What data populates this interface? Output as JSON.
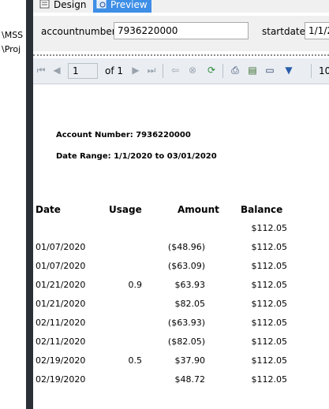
{
  "left_pane": {
    "lines": [
      "\\MSS",
      "\\Proj"
    ]
  },
  "tabs": [
    {
      "label": "Design"
    },
    {
      "label": "Preview"
    }
  ],
  "params": {
    "account_label": "accountnumber",
    "account_value": "7936220000",
    "start_label": "startdate",
    "start_value": "1/1/2"
  },
  "toolbar": {
    "page_current": "1",
    "page_of": "of 1",
    "zoom": "10"
  },
  "report": {
    "account_line": "Account Number: 7936220000",
    "date_line": "Date Range: 1/1/2020 to 03/01/2020",
    "columns": [
      "Date",
      "Usage",
      "Amount",
      "Balance"
    ],
    "rows": [
      {
        "date": "",
        "usage": "",
        "amount": "",
        "balance": "$112.05"
      },
      {
        "date": "01/07/2020",
        "usage": "",
        "amount": "($48.96)",
        "balance": "$112.05"
      },
      {
        "date": "01/07/2020",
        "usage": "",
        "amount": "($63.09)",
        "balance": "$112.05"
      },
      {
        "date": "01/21/2020",
        "usage": "0.9",
        "amount": "$63.93",
        "balance": "$112.05"
      },
      {
        "date": "01/21/2020",
        "usage": "",
        "amount": "$82.05",
        "balance": "$112.05"
      },
      {
        "date": "02/11/2020",
        "usage": "",
        "amount": "($63.93)",
        "balance": "$112.05"
      },
      {
        "date": "02/11/2020",
        "usage": "",
        "amount": "($82.05)",
        "balance": "$112.05"
      },
      {
        "date": "02/19/2020",
        "usage": "0.5",
        "amount": "$37.90",
        "balance": "$112.05"
      },
      {
        "date": "02/19/2020",
        "usage": "",
        "amount": "$48.72",
        "balance": "$112.05"
      }
    ]
  }
}
